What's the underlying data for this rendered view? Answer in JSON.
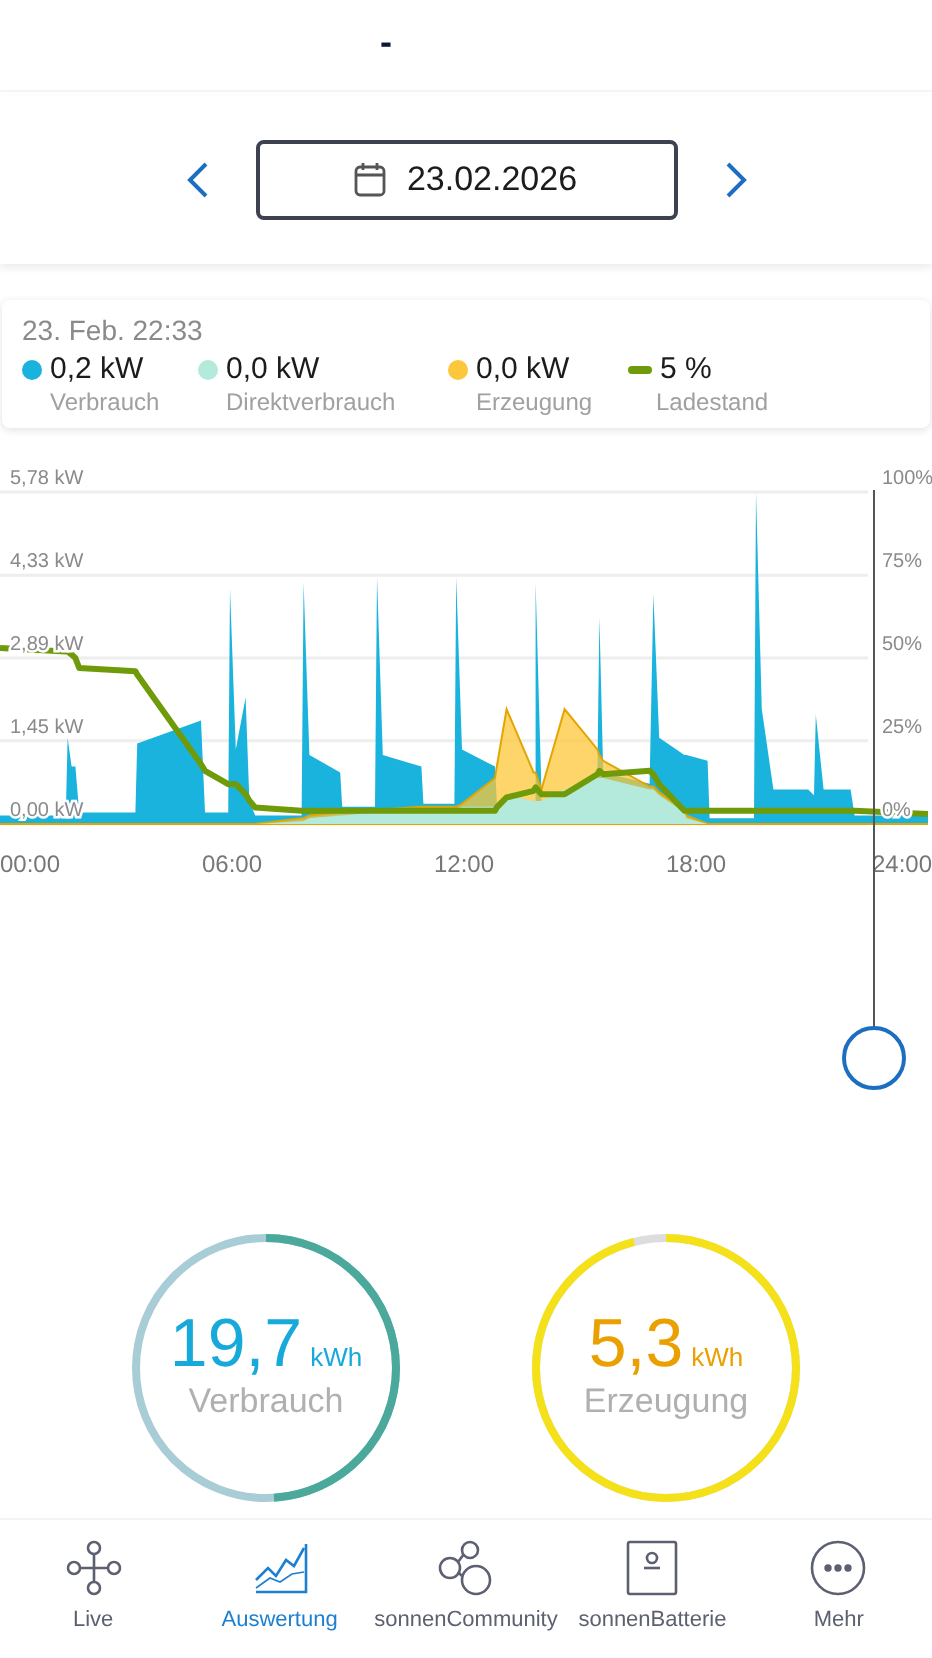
{
  "header": {
    "title": "-"
  },
  "date_bar": {
    "date": "23.02.2026"
  },
  "legend": {
    "timestamp": "23. Feb. 22:33",
    "items": [
      {
        "kind": "dot",
        "value": "0,2 kW"
      },
      {
        "kind": "dot",
        "value": "0,0 kW"
      },
      {
        "kind": "dot",
        "value": "0,0 kW"
      },
      {
        "kind": "line",
        "value": "5 %"
      }
    ]
  },
  "chart": {
    "chart_data": {
      "type": "area",
      "x": [
        0,
        1.7,
        1.75,
        1.85,
        1.95,
        2.05,
        3.5,
        3.55,
        5.2,
        5.3,
        5.9,
        5.95,
        6.1,
        6.35,
        6.45,
        6.6,
        7.8,
        7.85,
        8.0,
        8.8,
        8.85,
        9.7,
        9.75,
        9.9,
        10.9,
        10.95,
        11.75,
        11.8,
        11.95,
        12.8,
        12.85,
        13.1,
        13.8,
        13.85,
        14.0,
        14.6,
        15.45,
        15.5,
        15.6,
        16.8,
        16.9,
        17.05,
        17.7,
        17.75,
        18.3,
        18.35,
        19.5,
        19.55,
        19.7,
        20.0,
        20.9,
        21.05,
        21.1,
        21.3,
        22.0,
        22.1,
        24
      ],
      "series": [
        {
          "name": "Verbrauch",
          "color": "#1ab3dd",
          "values": [
            0.15,
            0.15,
            1.5,
            1.0,
            1.0,
            0.2,
            0.2,
            1.4,
            1.8,
            0.2,
            0.2,
            4.1,
            1.3,
            2.2,
            0.4,
            0.15,
            0.15,
            4.2,
            1.2,
            0.9,
            0.3,
            0.3,
            4.3,
            1.2,
            1.0,
            0.35,
            0.35,
            4.3,
            1.3,
            1.0,
            0.4,
            null,
            null,
            4.2,
            0.6,
            null,
            0.9,
            3.6,
            0.9,
            0.7,
            4.0,
            1.5,
            1.2,
            1.2,
            1.1,
            0.1,
            0.1,
            5.78,
            2.0,
            0.6,
            0.6,
            0.5,
            1.9,
            0.6,
            0.6,
            0.15,
            0.15
          ]
        },
        {
          "name": "Direktverbrauch",
          "color": "#b4eadb",
          "values": [
            0,
            0,
            0,
            0,
            0,
            0,
            0,
            0,
            0,
            0,
            0,
            0,
            0,
            0,
            0,
            0,
            0.05,
            0.05,
            0.1,
            0.15,
            0.15,
            0.2,
            0.2,
            0.2,
            0.25,
            0.25,
            0.25,
            0.25,
            0.3,
            0.3,
            0.3,
            0.5,
            0.4,
            0.4,
            0.4,
            0.6,
            0.8,
            0.8,
            0.8,
            0.6,
            0.6,
            0.5,
            0.2,
            0.1,
            0,
            0,
            0,
            0,
            0,
            0,
            0,
            0,
            0,
            0,
            0,
            0,
            0
          ]
        },
        {
          "name": "Erzeugung",
          "color": "#fcc73a",
          "values": [
            0,
            0,
            0,
            0,
            0,
            0,
            0,
            0,
            0,
            0,
            0,
            0,
            0,
            0,
            0,
            0,
            0.1,
            0.1,
            0.15,
            0.2,
            0.2,
            0.25,
            0.25,
            0.25,
            0.3,
            0.3,
            0.3,
            0.3,
            0.35,
            0.8,
            1.0,
            2.0,
            0.9,
            0.9,
            0.6,
            2.0,
            1.3,
            1.2,
            1.1,
            0.65,
            0.65,
            0.55,
            0.25,
            0.15,
            0,
            0,
            0,
            0,
            0,
            0,
            0,
            0,
            0,
            0,
            0,
            0,
            0
          ]
        },
        {
          "name": "Ladestand",
          "color": "#6f9a09",
          "type": "line",
          "axis": "y2",
          "values": [
            53,
            52,
            52,
            51,
            50,
            47,
            46,
            45,
            18,
            16,
            12,
            12,
            12,
            9,
            7,
            5,
            4,
            4,
            4,
            4,
            4,
            4,
            4,
            4,
            4,
            4,
            4,
            4,
            4,
            4,
            5,
            8,
            10,
            11,
            9,
            9,
            15,
            16,
            15,
            16,
            15,
            12,
            4,
            4,
            4,
            4,
            4,
            4,
            4,
            4,
            4,
            4,
            4,
            4,
            4,
            4,
            3
          ]
        }
      ],
      "xlim": [
        0,
        24
      ],
      "ylim": [
        0,
        5.78
      ],
      "y2lim": [
        0,
        100
      ],
      "grid": true,
      "y2ticks": [
        {
          "value": 100,
          "label": "100%"
        },
        {
          "value": 75,
          "label": "75%"
        },
        {
          "value": 50,
          "label": "50%"
        },
        {
          "value": 25,
          "label": "25%"
        },
        {
          "value": 0,
          "label": "0%"
        }
      ],
      "xticks": [
        {
          "value": 0,
          "label": "00:00"
        },
        {
          "value": 6,
          "label": "06:00"
        },
        {
          "value": 12,
          "label": "12:00"
        },
        {
          "value": 18,
          "label": "18:00"
        },
        {
          "value": 24,
          "label": "24:00"
        }
      ],
      "yticks": [
        {
          "value": 5.78,
          "label": "5,78 kW"
        },
        {
          "value": 4.33,
          "label": "4,33 kW"
        },
        {
          "value": 2.89,
          "label": "2,89 kW"
        },
        {
          "value": 1.45,
          "label": "1,45 kW"
        },
        {
          "value": 0,
          "label": "0,00 kW"
        }
      ]
    }
  },
  "totals": [
    {
      "value": "19,7",
      "unit": "kWh",
      "label": "Verbrauch",
      "level": 0.49
    },
    {
      "value": "5,3",
      "unit": "kWh",
      "label": "Erzeugung",
      "level": 0.96
    }
  ],
  "nav": [
    {
      "label": "Live",
      "selected": false
    },
    {
      "label": "Auswertung",
      "selected": true
    },
    {
      "label": "sonnenCommunity",
      "selected": false
    },
    {
      "label": "sonnenBatterie",
      "selected": false
    },
    {
      "label": "Mehr",
      "selected": false
    }
  ]
}
